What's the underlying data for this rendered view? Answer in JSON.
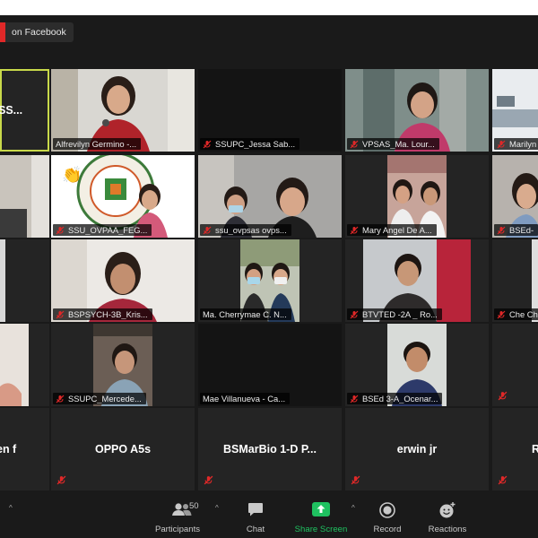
{
  "live_badge": {
    "text": "on Facebook"
  },
  "tiles": {
    "r1c1": "SS...",
    "r1c2": "Alfrevilyn Germino -...",
    "r1c3": "SSUPC_Jessa Sab...",
    "r1c4": "VPSAS_Ma. Lour...",
    "r1c5": "Marilyn",
    "r2c2": "SSU_OVPAA_FEG...",
    "r2c3": "ssu_ovpsas ovps...",
    "r2c4": "Mary Angel De A...",
    "r2c5": "BSEd-",
    "r3c2": "BSPSYCH-3B_Kris...",
    "r3c3": "Ma. Cherrymae C. N...",
    "r3c4": "BTVTED -2A _ Ro...",
    "r3c5": "Che Ch",
    "r4c2": "SSUPC_Mercede...",
    "r4c3": "Mae Villanueva - Ca...",
    "r4c4": "BSEd 3-A_Ocenar...",
    "r5c1": "en f",
    "r5c2": "OPPO A5s",
    "r5c3": "BSMarBio 1-D P...",
    "r5c4": "erwin jr",
    "r5c5": "R"
  },
  "toolbar": {
    "participants_count": "50",
    "participants_label": "Participants",
    "chat_label": "Chat",
    "share_label": "Share Screen",
    "record_label": "Record",
    "reactions_label": "Reactions"
  },
  "colors": {
    "share_green": "#1fc160",
    "live_red": "#e02828",
    "mute_red": "#e02828",
    "speaker_outline": "#c8d94a"
  }
}
